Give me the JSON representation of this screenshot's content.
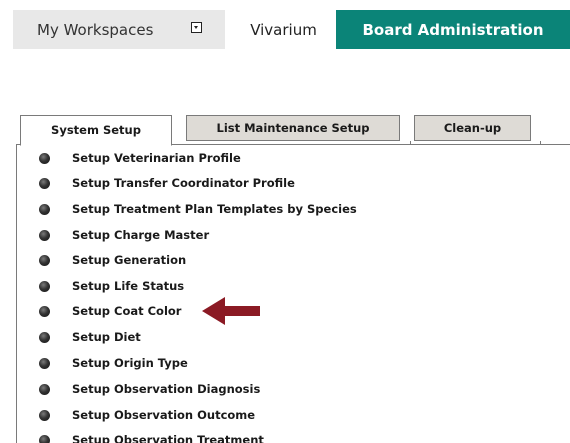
{
  "top_nav": {
    "workspaces_label": "My Workspaces",
    "vivarium_label": "Vivarium",
    "board_admin_label": "Board Administration",
    "accent_color": "#0b8478"
  },
  "tabs": [
    {
      "label": "System Setup",
      "active": true
    },
    {
      "label": "List Maintenance Setup",
      "active": false
    },
    {
      "label": "Clean-up",
      "active": false
    }
  ],
  "menu_items": [
    "Setup Veterinarian Profile",
    "Setup Transfer Coordinator Profile",
    "Setup Treatment Plan Templates by Species",
    "Setup Charge Master",
    "Setup Generation",
    "Setup Life Status",
    "Setup Coat Color",
    "Setup Diet",
    "Setup Origin Type",
    "Setup Observation Diagnosis",
    "Setup Observation Outcome",
    "Setup Observation Treatment"
  ],
  "annotation": {
    "arrow_color": "#8b1a24",
    "points_to_item": "Setup Coat Color"
  }
}
